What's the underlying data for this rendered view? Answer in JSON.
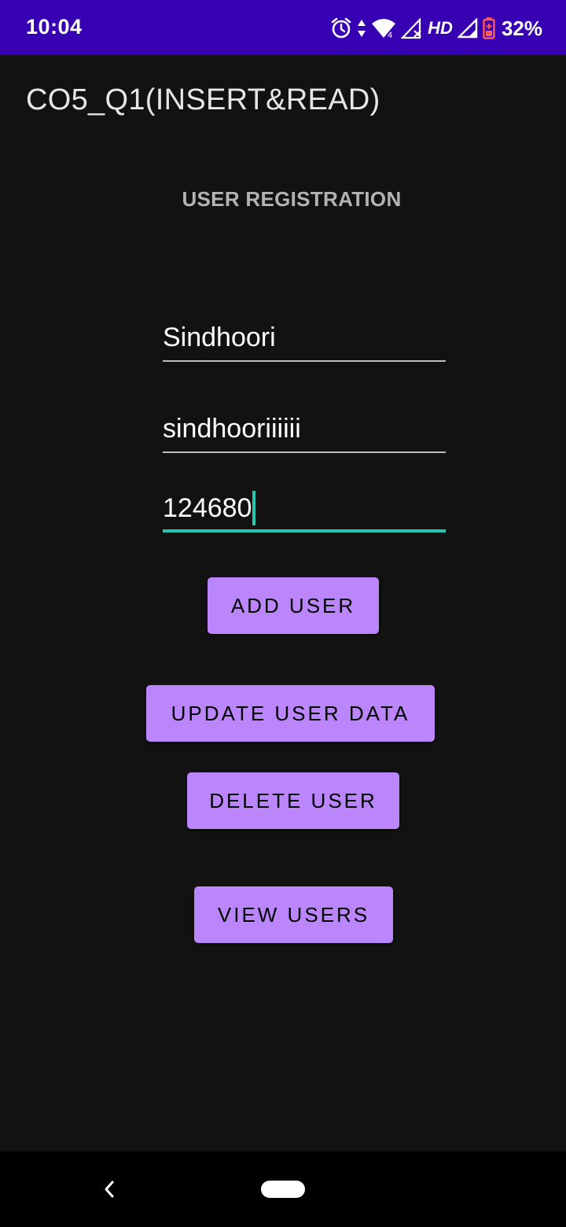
{
  "status_bar": {
    "time": "10:04",
    "network_type": "HD",
    "battery_percent": "32%",
    "wifi_badge": "4",
    "background_color": "#3700B3",
    "icons": [
      "alarm-icon",
      "data-arrows-icon",
      "wifi-icon",
      "signal-no-service-icon",
      "signal-icon",
      "battery-low-icon"
    ]
  },
  "app_bar": {
    "title": "CO5_Q1(INSERT&READ)"
  },
  "form": {
    "heading": "USER REGISTRATION",
    "fields": [
      {
        "value": "Sindhoori",
        "focused": false
      },
      {
        "value": "sindhooriiiiii",
        "focused": false
      },
      {
        "value": "124680",
        "focused": true
      }
    ]
  },
  "buttons": {
    "add_user": "ADD USER",
    "update_user_data": "UPDATE USER DATA",
    "delete_user": "DELETE USER",
    "view_users": "VIEW USERS",
    "color": "#BB86FC"
  },
  "accent_color": "#26C6B0",
  "nav_bar": {
    "icons": [
      "back-icon",
      "home-pill-icon"
    ]
  }
}
